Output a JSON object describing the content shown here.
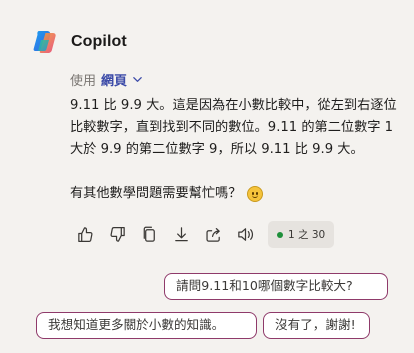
{
  "app": {
    "name": "Copilot",
    "logo_icon": "copilot-logo-icon"
  },
  "mode": {
    "prefix": "使用",
    "value": "網頁"
  },
  "answer": {
    "paragraph": "9.11 比 9.9 大。這是因為在小數比較中，從左到右逐位比較數字，直到找到不同的數位。9.11 的第二位數字 1 大於 9.9 的第二位數字 9，所以 9.11 比 9.9 大。",
    "followup": "有其他數學問題需要幫忙嗎？"
  },
  "actions": {
    "icons": [
      "thumbs-up-icon",
      "thumbs-down-icon",
      "copy-icon",
      "download-icon",
      "share-icon",
      "read-aloud-icon"
    ],
    "counter": "1 之 30",
    "status_color": "#1e8f3a"
  },
  "suggestions": [
    "請問9.11和10哪個數字比較大?",
    "我想知道更多關於小數的知識。",
    "沒有了，謝謝!"
  ],
  "colors": {
    "background": "#f4f2ef",
    "accent_text": "#3b4aa8",
    "chip_border": "#8f3a6a"
  }
}
